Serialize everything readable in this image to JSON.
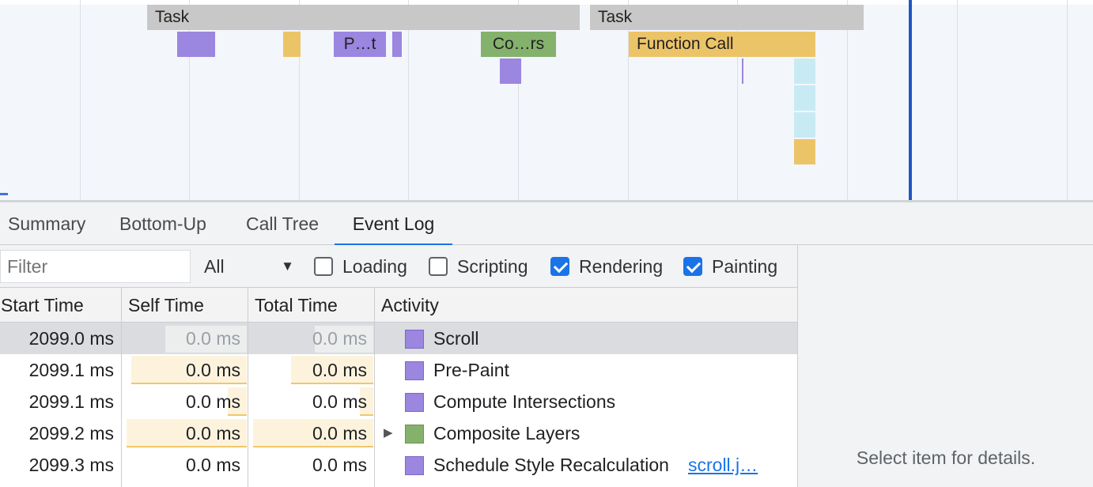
{
  "flame": {
    "events": [
      {
        "id": "task1",
        "label": "Task",
        "kind": "task"
      },
      {
        "id": "task2",
        "label": "Task",
        "kind": "task"
      },
      {
        "id": "paint1",
        "label": "",
        "kind": "paint"
      },
      {
        "id": "script1",
        "label": "",
        "kind": "script"
      },
      {
        "id": "prepaint",
        "label": "P…t",
        "kind": "paint"
      },
      {
        "id": "paint2",
        "label": "",
        "kind": "paint"
      },
      {
        "id": "composite",
        "label": "Co…rs",
        "kind": "comp"
      },
      {
        "id": "paint3",
        "label": "",
        "kind": "paint"
      },
      {
        "id": "function_call",
        "label": "Function Call",
        "kind": "script"
      }
    ]
  },
  "tabs": [
    {
      "label": "Summary",
      "active": false
    },
    {
      "label": "Bottom-Up",
      "active": false
    },
    {
      "label": "Call Tree",
      "active": false
    },
    {
      "label": "Event Log",
      "active": true
    }
  ],
  "toolbar": {
    "filter_placeholder": "Filter",
    "select_value": "All",
    "checkboxes": [
      {
        "label": "Loading",
        "checked": false
      },
      {
        "label": "Scripting",
        "checked": false
      },
      {
        "label": "Rendering",
        "checked": true
      },
      {
        "label": "Painting",
        "checked": true
      }
    ]
  },
  "table": {
    "headers": [
      "Start Time",
      "Self Time",
      "Total Time",
      "Activity"
    ],
    "rows": [
      {
        "start": "2099.0 ms",
        "self": "0.0 ms",
        "total": "0.0 ms",
        "activity": "Scroll",
        "category": "paint",
        "selected": true,
        "expandable": false,
        "link": ""
      },
      {
        "start": "2099.1 ms",
        "self": "0.0 ms",
        "total": "0.0 ms",
        "activity": "Pre-Paint",
        "category": "paint",
        "selected": false,
        "expandable": false,
        "link": ""
      },
      {
        "start": "2099.1 ms",
        "self": "0.0 ms",
        "total": "0.0 ms",
        "activity": "Compute Intersections",
        "category": "paint",
        "selected": false,
        "expandable": false,
        "link": ""
      },
      {
        "start": "2099.2 ms",
        "self": "0.0 ms",
        "total": "0.0 ms",
        "activity": "Composite Layers",
        "category": "comp",
        "selected": false,
        "expandable": true,
        "link": ""
      },
      {
        "start": "2099.3 ms",
        "self": "0.0 ms",
        "total": "0.0 ms",
        "activity": "Schedule Style Recalculation",
        "category": "paint",
        "selected": false,
        "expandable": false,
        "link": "scroll.j…"
      }
    ]
  },
  "details": {
    "placeholder": "Select item for details."
  }
}
